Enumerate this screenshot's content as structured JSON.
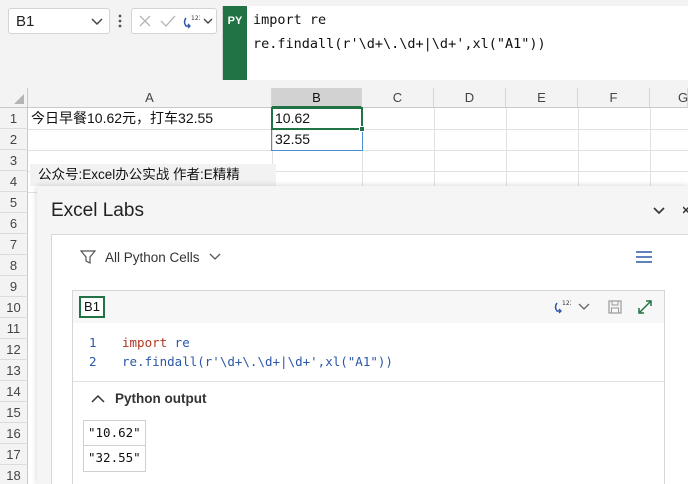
{
  "name_box": {
    "value": "B1"
  },
  "formula_bar": {
    "badge": "PY",
    "lines": [
      "import re",
      "re.findall(r'\\d+\\.\\d+|\\d+',xl(\"A1\"))"
    ]
  },
  "grid": {
    "columns": [
      "A",
      "B",
      "C",
      "D",
      "E",
      "F",
      "G"
    ],
    "selected_column": "B",
    "rows": [
      "1",
      "2",
      "3",
      "4",
      "5",
      "6",
      "7",
      "8",
      "9",
      "10",
      "11",
      "12",
      "13",
      "14",
      "15",
      "16",
      "17",
      "18"
    ],
    "cells": {
      "A1": "今日早餐10.62元，打车32.55",
      "B1": "10.62",
      "B2": "32.55"
    },
    "watermark": "公众号:Excel办公实战  作者:E精精"
  },
  "labs_pane": {
    "title": "Excel Labs",
    "filter_label": "All Python Cells",
    "card": {
      "cell_ref": "B1",
      "code": [
        {
          "line_no": "1",
          "keyword": "import",
          "rest": " re"
        },
        {
          "line_no": "2",
          "text": "re.findall(r'\\d+\\.\\d+|\\d+',xl(\"A1\"))"
        }
      ],
      "output_title": "Python output",
      "output_values": [
        "\"10.62\"",
        "\"32.55\""
      ]
    }
  },
  "colors": {
    "accent_green": "#217346",
    "spill_blue": "#4a8fd6"
  }
}
